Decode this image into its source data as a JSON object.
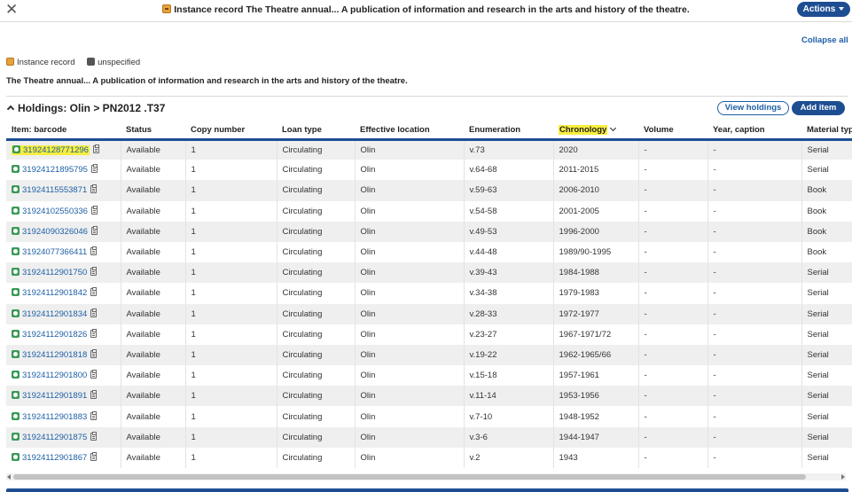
{
  "header": {
    "title": "Instance record The Theatre annual... A publication of information and research in the arts and history of the theatre.",
    "actions_label": "Actions"
  },
  "collapse_all": "Collapse all",
  "legend": {
    "instance_record": "Instance record",
    "unspecified": "unspecified"
  },
  "instance_title": "The Theatre annual... A publication of information and research in the arts and history of the theatre.",
  "holdings": {
    "heading": "Holdings: Olin > PN2012 .T37",
    "view_holdings_label": "View holdings",
    "add_item_label": "Add item"
  },
  "table": {
    "columns": [
      "Item: barcode",
      "Status",
      "Copy number",
      "Loan type",
      "Effective location",
      "Enumeration",
      "Chronology",
      "Volume",
      "Year, caption",
      "Material type"
    ],
    "sorted_column": "Chronology",
    "rows": [
      [
        "31924128771296",
        "Available",
        "1",
        "Circulating",
        "Olin",
        "v.73",
        "2020",
        "-",
        "-",
        "Serial"
      ],
      [
        "31924121895795",
        "Available",
        "1",
        "Circulating",
        "Olin",
        "v.64-68",
        "2011-2015",
        "-",
        "-",
        "Serial"
      ],
      [
        "31924115553871",
        "Available",
        "1",
        "Circulating",
        "Olin",
        "v.59-63",
        "2006-2010",
        "-",
        "-",
        "Book"
      ],
      [
        "31924102550336",
        "Available",
        "1",
        "Circulating",
        "Olin",
        "v.54-58",
        "2001-2005",
        "-",
        "-",
        "Book"
      ],
      [
        "31924090326046",
        "Available",
        "1",
        "Circulating",
        "Olin",
        "v.49-53",
        "1996-2000",
        "-",
        "-",
        "Book"
      ],
      [
        "31924077366411",
        "Available",
        "1",
        "Circulating",
        "Olin",
        "v.44-48",
        "1989/90-1995",
        "-",
        "-",
        "Book"
      ],
      [
        "31924112901750",
        "Available",
        "1",
        "Circulating",
        "Olin",
        "v.39-43",
        "1984-1988",
        "-",
        "-",
        "Serial"
      ],
      [
        "31924112901842",
        "Available",
        "1",
        "Circulating",
        "Olin",
        "v.34-38",
        "1979-1983",
        "-",
        "-",
        "Serial"
      ],
      [
        "31924112901834",
        "Available",
        "1",
        "Circulating",
        "Olin",
        "v.28-33",
        "1972-1977",
        "-",
        "-",
        "Serial"
      ],
      [
        "31924112901826",
        "Available",
        "1",
        "Circulating",
        "Olin",
        "v.23-27",
        "1967-1971/72",
        "-",
        "-",
        "Serial"
      ],
      [
        "31924112901818",
        "Available",
        "1",
        "Circulating",
        "Olin",
        "v.19-22",
        "1962-1965/66",
        "-",
        "-",
        "Serial"
      ],
      [
        "31924112901800",
        "Available",
        "1",
        "Circulating",
        "Olin",
        "v.15-18",
        "1957-1961",
        "-",
        "-",
        "Serial"
      ],
      [
        "31924112901891",
        "Available",
        "1",
        "Circulating",
        "Olin",
        "v.11-14",
        "1953-1956",
        "-",
        "-",
        "Serial"
      ],
      [
        "31924112901883",
        "Available",
        "1",
        "Circulating",
        "Olin",
        "v.7-10",
        "1948-1952",
        "-",
        "-",
        "Serial"
      ],
      [
        "31924112901875",
        "Available",
        "1",
        "Circulating",
        "Olin",
        "v.3-6",
        "1944-1947",
        "-",
        "-",
        "Serial"
      ],
      [
        "31924112901867",
        "Available",
        "1",
        "Circulating",
        "Olin",
        "v.2",
        "1943",
        "-",
        "-",
        "Serial"
      ]
    ]
  },
  "icons": {
    "close": "close-icon",
    "instance_record": "instance-record-icon",
    "item_status": "item-status-icon",
    "copy": "copy-barcode-icon"
  },
  "colors": {
    "accent": "#1d4e92",
    "link": "#1d5fa6",
    "highlight": "#f7ee3d"
  }
}
